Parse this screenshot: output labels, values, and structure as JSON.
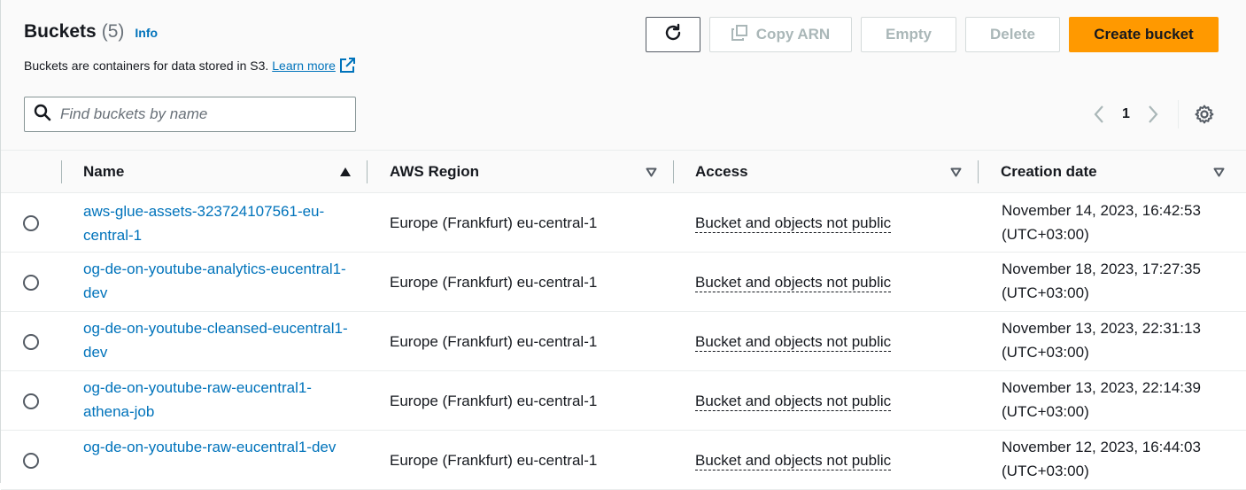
{
  "header": {
    "title": "Buckets",
    "count": "(5)",
    "info": "Info",
    "description": "Buckets are containers for data stored in S3.",
    "learn_more": "Learn more"
  },
  "toolbar": {
    "refresh_icon": "refresh-icon",
    "copy_arn": "Copy ARN",
    "empty": "Empty",
    "delete": "Delete",
    "create_bucket": "Create bucket"
  },
  "search": {
    "placeholder": "Find buckets by name"
  },
  "pagination": {
    "current_page": "1"
  },
  "columns": {
    "name": "Name",
    "region": "AWS Region",
    "access": "Access",
    "creation_date": "Creation date"
  },
  "buckets": [
    {
      "name": "aws-glue-assets-323724107561-eu-central-1",
      "region": "Europe (Frankfurt) eu-central-1",
      "access": "Bucket and objects not public",
      "created": "November 14, 2023, 16:42:53 (UTC+03:00)"
    },
    {
      "name": "og-de-on-youtube-analytics-eucentral1-dev",
      "region": "Europe (Frankfurt) eu-central-1",
      "access": "Bucket and objects not public",
      "created": "November 18, 2023, 17:27:35 (UTC+03:00)"
    },
    {
      "name": "og-de-on-youtube-cleansed-eucentral1-dev",
      "region": "Europe (Frankfurt) eu-central-1",
      "access": "Bucket and objects not public",
      "created": "November 13, 2023, 22:31:13 (UTC+03:00)"
    },
    {
      "name": "og-de-on-youtube-raw-eucentral1-athena-job",
      "region": "Europe (Frankfurt) eu-central-1",
      "access": "Bucket and objects not public",
      "created": "November 13, 2023, 22:14:39 (UTC+03:00)"
    },
    {
      "name": "og-de-on-youtube-raw-eucentral1-dev",
      "region": "Europe (Frankfurt) eu-central-1",
      "access": "Bucket and objects not public",
      "created": "November 12, 2023, 16:44:03 (UTC+03:00)"
    }
  ],
  "colors": {
    "accent": "#ff9900",
    "link": "#0073bb",
    "text": "#16191f"
  }
}
